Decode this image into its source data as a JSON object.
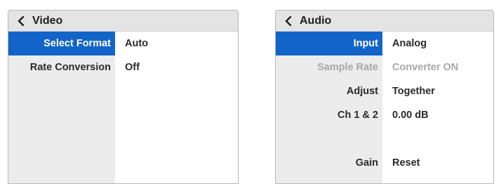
{
  "video": {
    "title": "Video",
    "rows": [
      {
        "label": "Select Format",
        "value": "Auto"
      },
      {
        "label": "Rate Conversion",
        "value": "Off"
      }
    ]
  },
  "audio": {
    "title": "Audio",
    "rows": [
      {
        "label": "Input",
        "value": "Analog"
      },
      {
        "label": "Sample Rate",
        "value": "Converter ON"
      },
      {
        "label": "Adjust",
        "value": "Together"
      },
      {
        "label": "Ch 1 & 2",
        "value": "0.00 dB"
      },
      {
        "label": "Gain",
        "value": "Reset"
      }
    ]
  },
  "colors": {
    "selected": "#1264c8",
    "header_bg": "#e4e4e4",
    "label_bg": "#ececec",
    "disabled_text": "#a8a8a8"
  }
}
